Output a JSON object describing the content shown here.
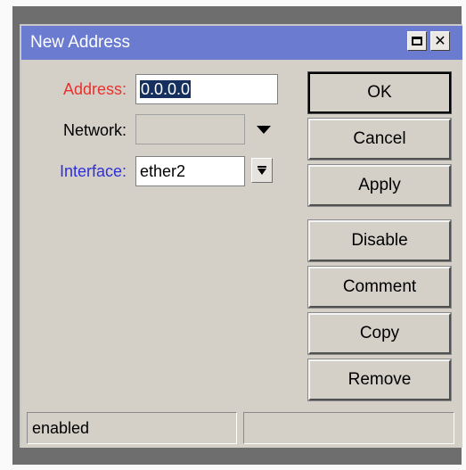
{
  "window": {
    "title": "New Address",
    "title_bar_color": "#6a7bd0",
    "maximize_icon": "maximize-icon",
    "close_icon": "close-icon",
    "close_glyph": "✕"
  },
  "form": {
    "address": {
      "label": "Address:",
      "value": "0.0.0.0",
      "label_color": "#e8322e",
      "selected": true
    },
    "network": {
      "label": "Network:",
      "value": "",
      "enabled": false,
      "icon": "dropdown-arrow-icon"
    },
    "interface": {
      "label": "Interface:",
      "value": "ether2",
      "label_color": "#2d2fd8",
      "icon": "dropdown-icon"
    }
  },
  "buttons": {
    "ok": "OK",
    "cancel": "Cancel",
    "apply": "Apply",
    "disable": "Disable",
    "comment": "Comment",
    "copy": "Copy",
    "remove": "Remove"
  },
  "status": {
    "left": "enabled",
    "right": ""
  }
}
